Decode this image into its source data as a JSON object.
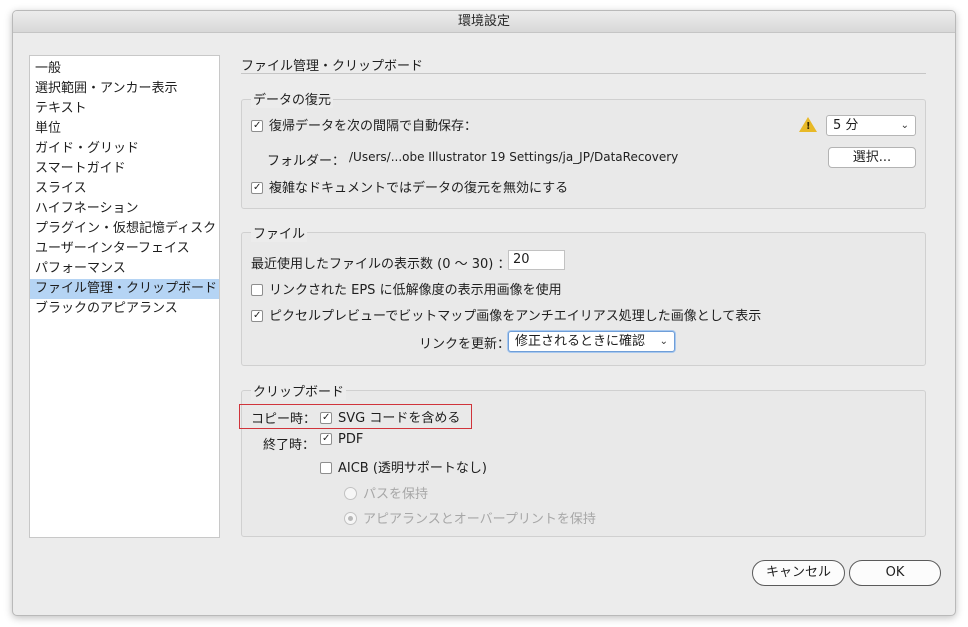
{
  "window": {
    "title": "環境設定"
  },
  "sidebar": {
    "items": [
      {
        "label": "一般"
      },
      {
        "label": "選択範囲・アンカー表示"
      },
      {
        "label": "テキスト"
      },
      {
        "label": "単位"
      },
      {
        "label": "ガイド・グリッド"
      },
      {
        "label": "スマートガイド"
      },
      {
        "label": "スライス"
      },
      {
        "label": "ハイフネーション"
      },
      {
        "label": "プラグイン・仮想記憶ディスク"
      },
      {
        "label": "ユーザーインターフェイス"
      },
      {
        "label": "パフォーマンス"
      },
      {
        "label": "ファイル管理・クリップボード",
        "selected": true
      },
      {
        "label": "ブラックのアピアランス"
      }
    ]
  },
  "main": {
    "section_title": "ファイル管理・クリップボード",
    "data_recovery": {
      "group_label": "データの復元",
      "autosave_label": "復帰データを次の間隔で自動保存：",
      "autosave_checked": true,
      "interval_value": "5 分",
      "folder_label": "フォルダー：",
      "folder_path": "/Users/...obe Illustrator 19 Settings/ja_JP/DataRecovery",
      "choose_button": "選択...",
      "disable_complex_label": "複雑なドキュメントではデータの復元を無効にする",
      "disable_complex_checked": true,
      "warning_icon": "warning-icon"
    },
    "files": {
      "group_label": "ファイル",
      "recent_files_label": "最近使用したファイルの表示数 (0 〜 30) ：",
      "recent_files_value": "20",
      "low_res_eps_label": "リンクされた EPS に低解像度の表示用画像を使用",
      "low_res_eps_checked": false,
      "pixel_preview_label": "ピクセルプレビューでビットマップ画像をアンチエイリアス処理した画像として表示",
      "pixel_preview_checked": true,
      "update_links_label": "リンクを更新：",
      "update_links_value": "修正されるときに確認"
    },
    "clipboard": {
      "group_label": "クリップボード",
      "copy_label": "コピー時：",
      "svg_label": "SVG コードを含める",
      "svg_checked": true,
      "quit_label": "終了時：",
      "pdf_label": "PDF",
      "pdf_checked": true,
      "aicb_label": "AICB (透明サポートなし)",
      "aicb_checked": false,
      "preserve_paths_label": "パスを保持",
      "preserve_appearance_label": "アピアランスとオーバープリントを保持"
    }
  },
  "footer": {
    "cancel_label": "キャンセル",
    "ok_label": "OK"
  },
  "colors": {
    "selection": "#b5d4f4",
    "highlight_box": "#d0343b",
    "warning": "#e8b927"
  }
}
